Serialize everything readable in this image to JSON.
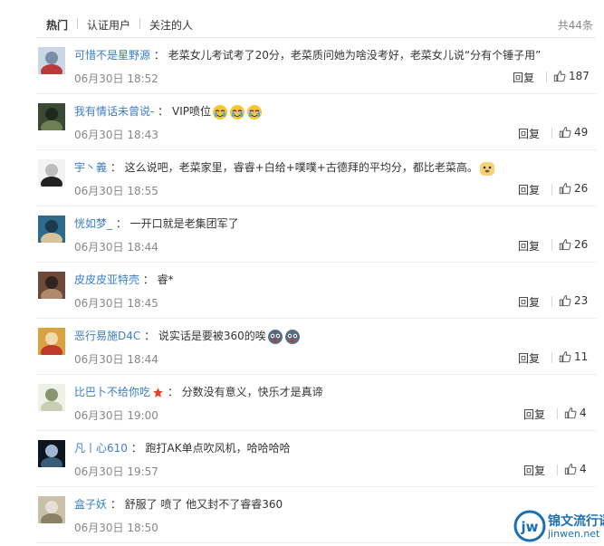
{
  "tabs": {
    "items": [
      "热门",
      "认证用户",
      "关注的人"
    ],
    "total": "共44条"
  },
  "comments": [
    {
      "name": "可惜不是星野源",
      "text": "老菜女儿考试考了20分，老菜质问她为啥没考好，老菜女儿说“分有个锤子用”",
      "time": "06月30日 18:52",
      "reply": "回复",
      "likes": "187",
      "emoji": []
    },
    {
      "name": "我有情话未曾说-",
      "text": "VIP喷位",
      "time": "06月30日 18:43",
      "reply": "回复",
      "likes": "49",
      "emoji": [
        "cry-laugh-emoji",
        "cry-laugh-emoji",
        "cry-laugh-emoji"
      ]
    },
    {
      "name": "宇丶義",
      "text": "这么说吧，老菜家里，睿睿+白给+噗噗+古德拜的平均分，都比老菜高。",
      "time": "06月30日 18:55",
      "reply": "回复",
      "likes": "26",
      "emoji": [
        "doge-emoji"
      ]
    },
    {
      "name": "恍如梦_",
      "text": "一开口就是老集团军了",
      "time": "06月30日 18:44",
      "reply": "回复",
      "likes": "26",
      "emoji": []
    },
    {
      "name": "皮皮皮亚特壳",
      "text": "睿*",
      "time": "06月30日 18:45",
      "reply": "回复",
      "likes": "23",
      "emoji": []
    },
    {
      "name": "恶行易施D4C",
      "text": "说实话是要被360的唉",
      "time": "06月30日 18:44",
      "reply": "回复",
      "likes": "11",
      "emoji": [
        "shocked-emoji",
        "shocked-emoji"
      ]
    },
    {
      "name": "比巴卜不给你吃",
      "text": "分数没有意义，快乐才是真谛",
      "time": "06月30日 19:00",
      "reply": "回复",
      "likes": "4",
      "emoji": [],
      "star": true
    },
    {
      "name": "凡丨心610",
      "text": "跑打AK单点吹风机，哈哈哈哈",
      "time": "06月30日 19:57",
      "reply": "回复",
      "likes": "4",
      "emoji": []
    },
    {
      "name": "盒子妖",
      "text": "舒服了 喷了 他又封不了睿睿360",
      "time": "06月30日 18:50",
      "reply": "",
      "likes": "",
      "emoji": []
    }
  ],
  "avatars": [
    {
      "icon": "ultraman-avatar",
      "colors": [
        "#c9d6e6",
        "#b83a3a",
        "#7a8da6"
      ]
    },
    {
      "icon": "dark-figure-avatar",
      "colors": [
        "#3b4a35",
        "#6f7f55",
        "#1e2a1c"
      ]
    },
    {
      "icon": "panda-avatar",
      "colors": [
        "#f2f2f2",
        "#222222",
        "#bdbdbd"
      ]
    },
    {
      "icon": "anime-boy-avatar",
      "colors": [
        "#2e6b8a",
        "#d9c29a",
        "#1b3a4e"
      ]
    },
    {
      "icon": "face-avatar",
      "colors": [
        "#6b4a3a",
        "#b08a6a",
        "#2f2420"
      ]
    },
    {
      "icon": "anime-character-avatar",
      "colors": [
        "#d9a341",
        "#c0392b",
        "#f3d9b0"
      ]
    },
    {
      "icon": "white-hair-anime-avatar",
      "colors": [
        "#eef1e6",
        "#c8cfb4",
        "#8a9470"
      ]
    },
    {
      "icon": "night-avatar",
      "colors": [
        "#0d1620",
        "#3a5a78",
        "#9fb7cf"
      ]
    },
    {
      "icon": "mixed-avatar",
      "colors": [
        "#c9c0a8",
        "#8b8068",
        "#e6e0d2"
      ]
    }
  ],
  "watermark": {
    "line1": "锦文流行语",
    "line2": "jinwen.net",
    "logo": "jw"
  }
}
